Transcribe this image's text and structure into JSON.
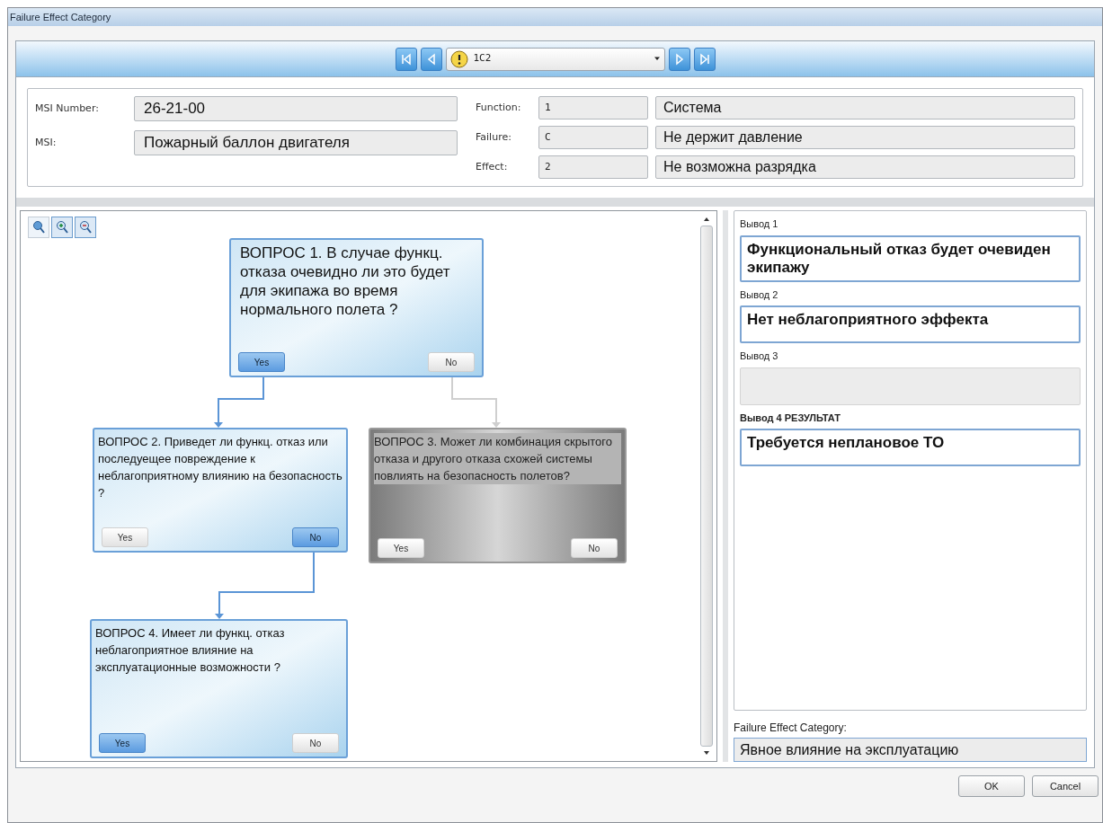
{
  "window": {
    "title": "Failure Effect Category"
  },
  "navigator": {
    "value": "1C2"
  },
  "info": {
    "msi_number": {
      "label": "MSI Number:",
      "value": "26-21-00"
    },
    "msi": {
      "label": "MSI:",
      "value": "Пожарный баллон двигателя"
    },
    "codes": [
      {
        "label": "Function:",
        "code": "1",
        "text": "Система"
      },
      {
        "label": "Failure:",
        "code": "C",
        "text": "Не держит давление"
      },
      {
        "label": "Effect:",
        "code": "2",
        "text": "Не возможна разрядка"
      }
    ]
  },
  "flowchart": {
    "questions": [
      {
        "text": "ВОПРОС 1. В случае функц. отказа очевидно ли это будет для экипажа во время нормального полета ?",
        "active": true,
        "answers": [
          {
            "label": "Yes",
            "selected": true
          },
          {
            "label": "No",
            "selected": false
          }
        ]
      },
      {
        "text": "ВОПРОС 2. Приведет ли функц. отказ или последуещее повреждение к неблагоприятному влиянию на безопасность ?",
        "active": true,
        "answers": [
          {
            "label": "Yes",
            "selected": false
          },
          {
            "label": "No",
            "selected": true
          }
        ]
      },
      {
        "text": "ВОПРОС 3. Может ли комбинация скрытого отказа и другого отказа схожей системы повлиять на безопасность полетов?",
        "active": false,
        "answers": [
          {
            "label": "Yes",
            "selected": false
          },
          {
            "label": "No",
            "selected": false
          }
        ]
      },
      {
        "text": "ВОПРОС 4. Имеет ли функц. отказ неблагоприятное влияние на эксплуатационные возможности ?",
        "active": true,
        "answers": [
          {
            "label": "Yes",
            "selected": true
          },
          {
            "label": "No",
            "selected": false
          }
        ]
      }
    ]
  },
  "conclusions": [
    {
      "label": "Вывод 1",
      "value": "Функциональный отказ будет очевиден экипажу",
      "emphasized": false
    },
    {
      "label": "Вывод 2",
      "value": "Нет неблагоприятного эффекта",
      "emphasized": false
    },
    {
      "label": "Вывод 3",
      "emphasized": false
    },
    {
      "label": "Вывод 4 РЕЗУЛЬТАТ",
      "value": "Требуется неплановое ТО",
      "emphasized": true
    }
  ],
  "category": {
    "label": "Failure Effect Category:",
    "value": "Явное влияние на эксплуатацию"
  },
  "buttons": [
    "OK",
    "Cancel"
  ]
}
